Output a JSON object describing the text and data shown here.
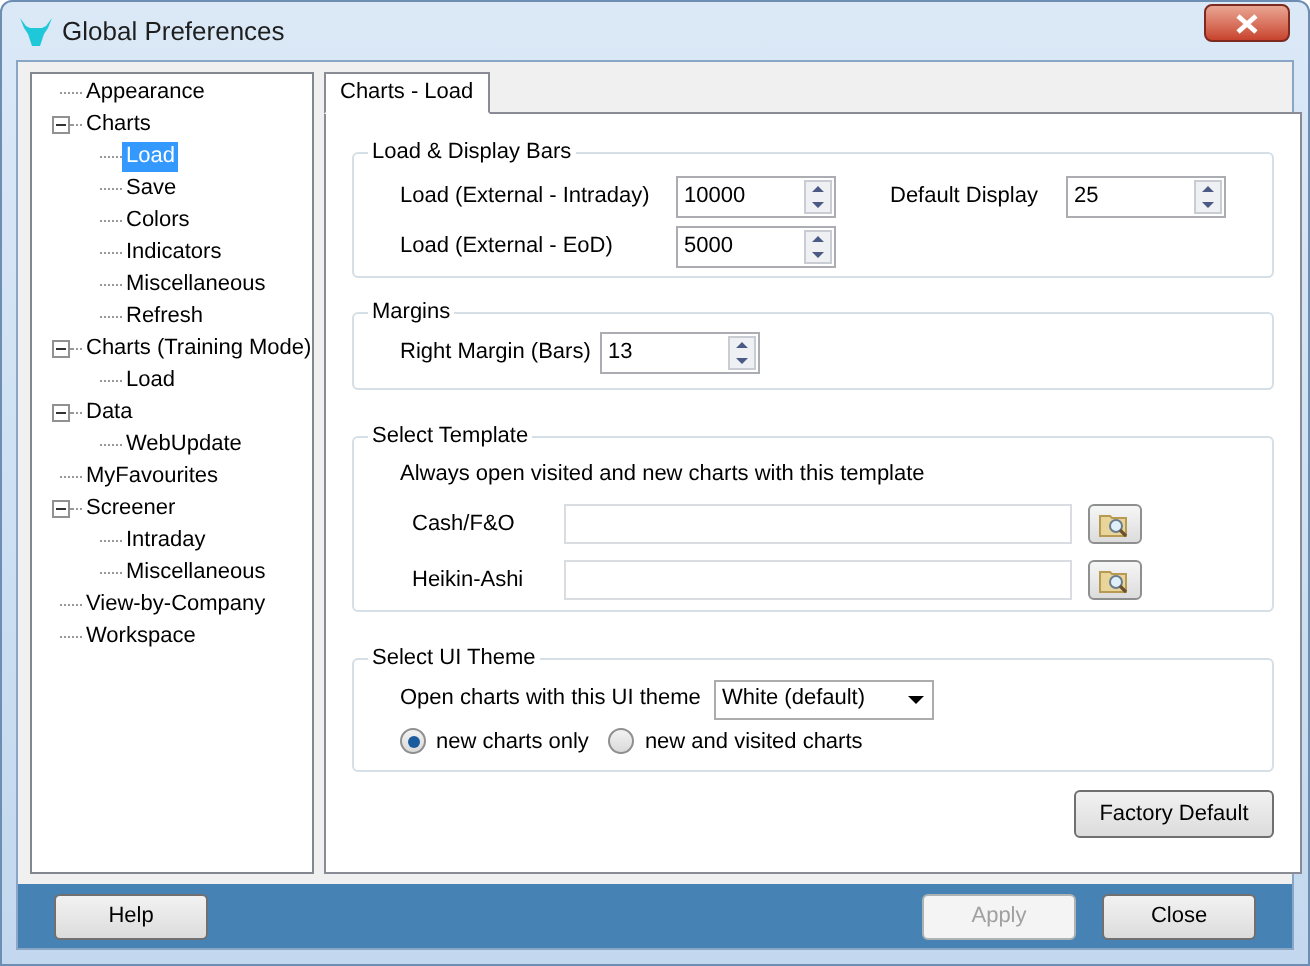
{
  "window": {
    "title": "Global Preferences"
  },
  "tree": [
    {
      "label": "Appearance",
      "selected": false
    },
    {
      "label": "Charts",
      "selected": false,
      "expanded": true,
      "children": [
        {
          "label": "Load",
          "selected": true
        },
        {
          "label": "Save",
          "selected": false
        },
        {
          "label": "Colors",
          "selected": false
        },
        {
          "label": "Indicators",
          "selected": false
        },
        {
          "label": "Miscellaneous",
          "selected": false
        },
        {
          "label": "Refresh",
          "selected": false
        }
      ]
    },
    {
      "label": "Charts (Training Mode)",
      "selected": false,
      "expanded": true,
      "children": [
        {
          "label": "Load",
          "selected": false
        }
      ]
    },
    {
      "label": "Data",
      "selected": false,
      "expanded": true,
      "children": [
        {
          "label": "WebUpdate",
          "selected": false
        }
      ]
    },
    {
      "label": "MyFavourites",
      "selected": false
    },
    {
      "label": "Screener",
      "selected": false,
      "expanded": true,
      "children": [
        {
          "label": "Intraday",
          "selected": false
        },
        {
          "label": "Miscellaneous",
          "selected": false
        }
      ]
    },
    {
      "label": "View-by-Company",
      "selected": false
    },
    {
      "label": "Workspace",
      "selected": false
    }
  ],
  "tabs": [
    {
      "label": "Charts - Load",
      "selected": true
    }
  ],
  "load_display_bars": {
    "title": "Load & Display Bars",
    "fields": [
      {
        "label": "Load (External - Intraday)",
        "value": "10000"
      },
      {
        "label": "Load (External - EoD)",
        "value": "5000"
      }
    ],
    "default_display": {
      "label": "Default Display",
      "value": "25"
    }
  },
  "margins": {
    "title": "Margins",
    "fields": [
      {
        "label": "Right Margin (Bars)",
        "value": "13"
      }
    ]
  },
  "select_template": {
    "title": "Select Template",
    "note": "Always open visited and new charts with this template",
    "rows": [
      {
        "label": "Cash/F&O"
      },
      {
        "label": "Heikin-Ashi"
      }
    ]
  },
  "select_ui_theme": {
    "title": "Select UI Theme",
    "label": "Open charts with this UI theme",
    "value": "White (default)",
    "radios": [
      {
        "label": "new charts only",
        "selected": true
      },
      {
        "label": "new and visited charts",
        "selected": false
      }
    ]
  },
  "factory_default": {
    "label": "Factory Default"
  },
  "footer_buttons": [
    {
      "label": "Help",
      "disabled": false,
      "kind": "left"
    },
    {
      "label": "Apply",
      "disabled": true,
      "kind": "right"
    },
    {
      "label": "Close",
      "disabled": false,
      "kind": "right"
    }
  ]
}
